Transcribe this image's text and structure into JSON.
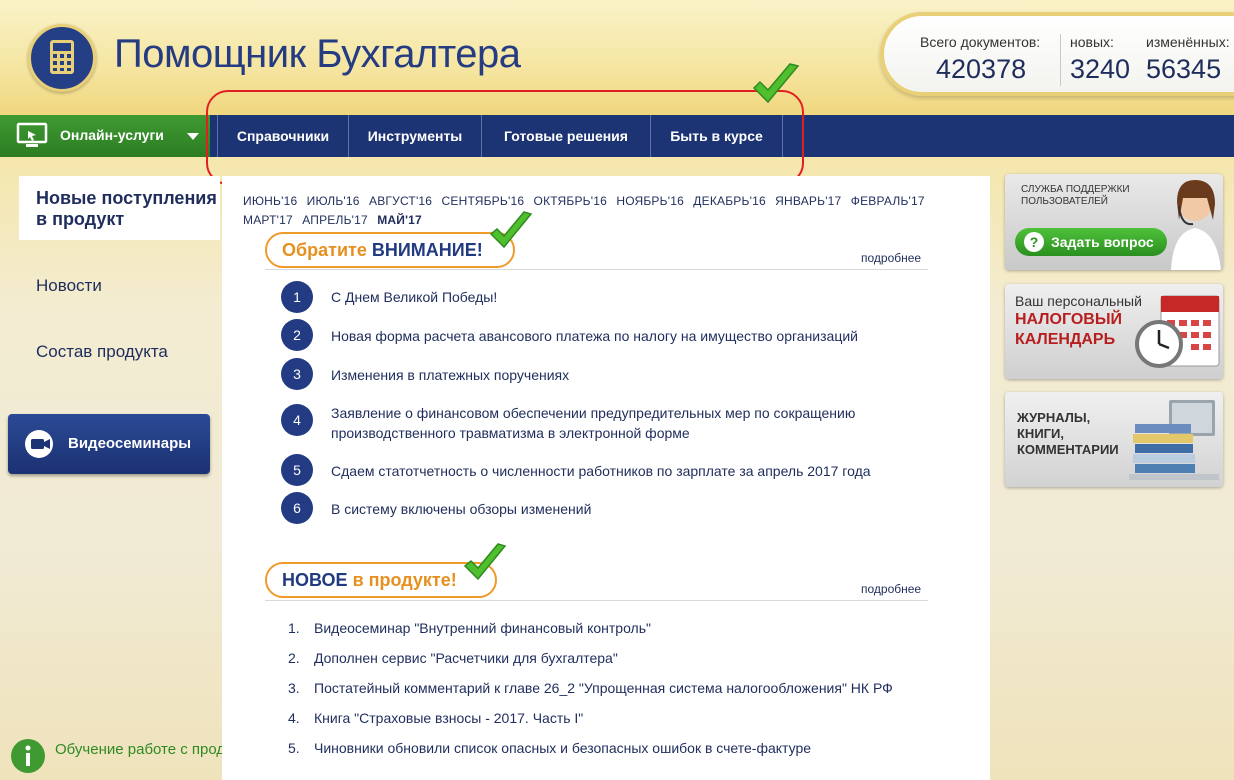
{
  "header": {
    "logo_title": "Помощник Бухгалтера",
    "stats": [
      {
        "label": "Всего документов:",
        "value": "420378"
      },
      {
        "label": "новых:",
        "value": "3240"
      },
      {
        "label": "изменённых:",
        "value": "56345"
      }
    ]
  },
  "nav": {
    "online": "Онлайн-услуги",
    "items": [
      "Справочники",
      "Инструменты",
      "Готовые решения",
      "Быть в курсе"
    ]
  },
  "sidebar": {
    "active": "Новые поступления в продукт",
    "links": [
      "Новости",
      "Состав продукта"
    ],
    "video_button": "Видеосеминары",
    "learn": "Обучение работе с продуктом"
  },
  "months": {
    "row1": [
      "ИЮНЬ'16",
      "ИЮЛЬ'16",
      "АВГУСТ'16",
      "СЕНТЯБРЬ'16",
      "ОКТЯБРЬ'16",
      "НОЯБРЬ'16",
      "ДЕКАБРЬ'16",
      "ЯНВАРЬ'17",
      "ФЕВРАЛЬ'17"
    ],
    "row2": [
      "МАРТ'17",
      "АПРЕЛЬ'17",
      "МАЙ'17"
    ]
  },
  "attention": {
    "title_a": "Обратите",
    "title_b": "ВНИМАНИЕ!",
    "more": "подробнее",
    "items": [
      {
        "num": "1",
        "text": "С Днем Великой Победы!"
      },
      {
        "num": "2",
        "text": "Новая форма расчета авансового платежа по налогу на имущество организаций"
      },
      {
        "num": "3",
        "text": "Изменения в платежных поручениях"
      },
      {
        "num": "4",
        "text": "Заявление о финансовом обеспечении предупредительных мер по сокращению производственного травматизма в электронной форме"
      },
      {
        "num": "5",
        "text": "Сдаем статотчетность о численности работников по зарплате за апрель 2017 года"
      },
      {
        "num": "6",
        "text": "В систему включены обзоры изменений"
      }
    ]
  },
  "new_in_product": {
    "title_a": "НОВОЕ",
    "title_b": "в продукте!",
    "more": "подробнее",
    "items": [
      {
        "num": "1.",
        "text": "Видеосеминар \"Внутренний финансовый контроль\""
      },
      {
        "num": "2.",
        "text": "Дополнен сервис \"Расчетчики для бухгалтера\""
      },
      {
        "num": "3.",
        "text": "Постатейный комментарий к главе 26_2 \"Упрощенная система налогообложения\" НК РФ"
      },
      {
        "num": "4.",
        "text": "Книга \"Страховые взносы - 2017. Часть I\""
      },
      {
        "num": "5.",
        "text": "Чиновники обновили список опасных и безопасных ошибок в счете-фактуре"
      }
    ]
  },
  "banners": {
    "support_small": "СЛУЖБА ПОДДЕРЖКИ ПОЛЬЗОВАТЕЛЕЙ",
    "support_button": "Задать вопрос",
    "calendar_small": "Ваш персональный",
    "calendar_big": "НАЛОГОВЫЙ КАЛЕНДАРЬ",
    "journals": "ЖУРНАЛЫ, КНИГИ, КОММЕНТАРИИ"
  }
}
